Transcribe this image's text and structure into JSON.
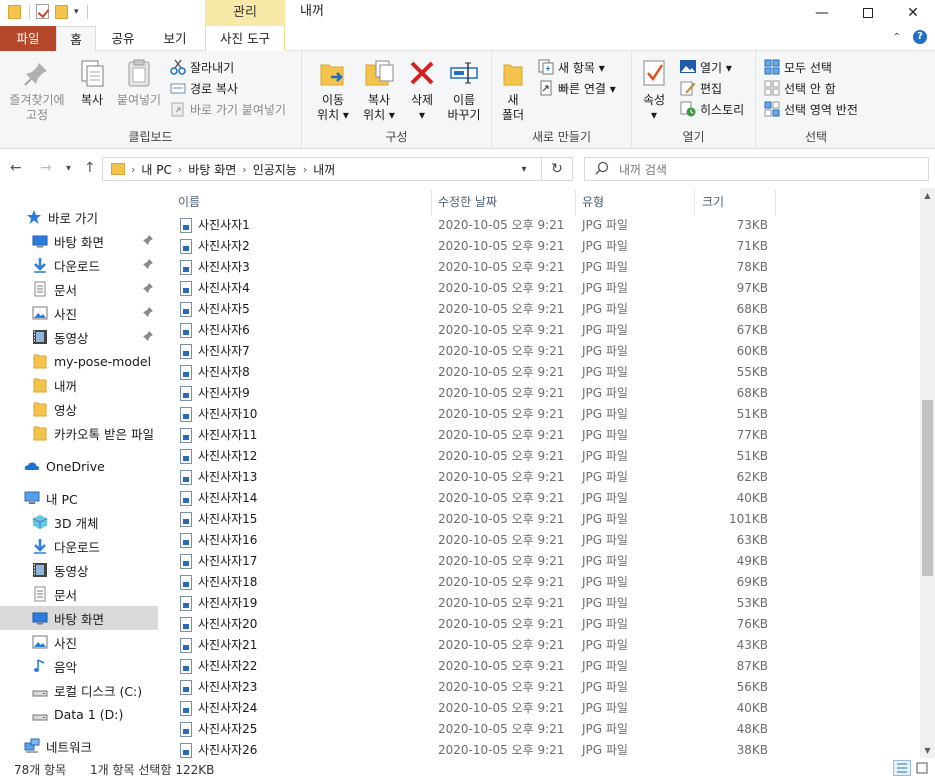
{
  "window": {
    "title": "내꺼",
    "context_tab_label": "관리",
    "minimize": "—",
    "close": "✕"
  },
  "ribbon_tabs": {
    "file": "파일",
    "home": "홈",
    "share": "공유",
    "view": "보기",
    "photo_tools": "사진 도구"
  },
  "ribbon": {
    "clipboard": {
      "label": "클립보드",
      "pin": [
        "즐겨찾기에",
        "고정"
      ],
      "copy": "복사",
      "paste": "붙여넣기",
      "cut": "잘라내기",
      "copy_path": "경로 복사",
      "paste_shortcut": "바로 가기 붙여넣기"
    },
    "organize": {
      "label": "구성",
      "move_to": [
        "이동",
        "위치 ▾"
      ],
      "copy_to": [
        "복사",
        "위치 ▾"
      ],
      "delete": [
        "삭제",
        "▾"
      ],
      "rename": [
        "이름",
        "바꾸기"
      ]
    },
    "new": {
      "label": "새로 만들기",
      "new_folder": [
        "새",
        "폴더"
      ],
      "new_item": "새 항목 ▾",
      "easy_access": "빠른 연결 ▾"
    },
    "open": {
      "label": "열기",
      "properties": [
        "속성",
        "▾"
      ],
      "open": "열기 ▾",
      "edit": "편집",
      "history": "히스토리"
    },
    "select": {
      "label": "선택",
      "select_all": "모두 선택",
      "select_none": "선택 안 함",
      "invert": "선택 영역 반전"
    }
  },
  "address": {
    "crumbs": [
      "내 PC",
      "바탕 화면",
      "인공지능",
      "내꺼"
    ],
    "search_placeholder": "내꺼 검색"
  },
  "nav": {
    "quick_access": "바로 가기",
    "items": [
      {
        "label": "바탕 화면",
        "icon": "desktop-icon",
        "pinned": true
      },
      {
        "label": "다운로드",
        "icon": "download-icon",
        "pinned": true
      },
      {
        "label": "문서",
        "icon": "document-icon",
        "pinned": true
      },
      {
        "label": "사진",
        "icon": "picture-icon",
        "pinned": true
      },
      {
        "label": "동영상",
        "icon": "video-icon",
        "pinned": true
      },
      {
        "label": "my-pose-model",
        "icon": "folder-icon",
        "pinned": false
      },
      {
        "label": "내꺼",
        "icon": "folder-icon",
        "pinned": false
      },
      {
        "label": "영상",
        "icon": "folder-icon",
        "pinned": false
      },
      {
        "label": "카카오톡 받은 파일",
        "icon": "folder-icon",
        "pinned": false
      }
    ],
    "onedrive": "OneDrive",
    "this_pc": "내 PC",
    "pc_items": [
      {
        "label": "3D 개체",
        "icon": "cube-icon"
      },
      {
        "label": "다운로드",
        "icon": "download-icon"
      },
      {
        "label": "동영상",
        "icon": "video-icon"
      },
      {
        "label": "문서",
        "icon": "document-icon"
      },
      {
        "label": "바탕 화면",
        "icon": "desktop-icon",
        "selected": true
      },
      {
        "label": "사진",
        "icon": "picture-icon"
      },
      {
        "label": "음악",
        "icon": "music-icon"
      },
      {
        "label": "로컬 디스크 (C:)",
        "icon": "drive-icon"
      },
      {
        "label": "Data 1 (D:)",
        "icon": "drive-icon"
      }
    ],
    "network": "네트워크"
  },
  "columns": {
    "name": "이름",
    "modified": "수정한 날짜",
    "type": "유형",
    "size": "크기"
  },
  "files": [
    {
      "name": "사진사자1",
      "date": "2020-10-05 오후 9:21",
      "type": "JPG 파일",
      "size": "73KB"
    },
    {
      "name": "사진사자2",
      "date": "2020-10-05 오후 9:21",
      "type": "JPG 파일",
      "size": "71KB"
    },
    {
      "name": "사진사자3",
      "date": "2020-10-05 오후 9:21",
      "type": "JPG 파일",
      "size": "78KB"
    },
    {
      "name": "사진사자4",
      "date": "2020-10-05 오후 9:21",
      "type": "JPG 파일",
      "size": "97KB"
    },
    {
      "name": "사진사자5",
      "date": "2020-10-05 오후 9:21",
      "type": "JPG 파일",
      "size": "68KB"
    },
    {
      "name": "사진사자6",
      "date": "2020-10-05 오후 9:21",
      "type": "JPG 파일",
      "size": "67KB"
    },
    {
      "name": "사진사자7",
      "date": "2020-10-05 오후 9:21",
      "type": "JPG 파일",
      "size": "60KB"
    },
    {
      "name": "사진사자8",
      "date": "2020-10-05 오후 9:21",
      "type": "JPG 파일",
      "size": "55KB"
    },
    {
      "name": "사진사자9",
      "date": "2020-10-05 오후 9:21",
      "type": "JPG 파일",
      "size": "68KB"
    },
    {
      "name": "사진사자10",
      "date": "2020-10-05 오후 9:21",
      "type": "JPG 파일",
      "size": "51KB"
    },
    {
      "name": "사진사자11",
      "date": "2020-10-05 오후 9:21",
      "type": "JPG 파일",
      "size": "77KB"
    },
    {
      "name": "사진사자12",
      "date": "2020-10-05 오후 9:21",
      "type": "JPG 파일",
      "size": "51KB"
    },
    {
      "name": "사진사자13",
      "date": "2020-10-05 오후 9:21",
      "type": "JPG 파일",
      "size": "62KB"
    },
    {
      "name": "사진사자14",
      "date": "2020-10-05 오후 9:21",
      "type": "JPG 파일",
      "size": "40KB"
    },
    {
      "name": "사진사자15",
      "date": "2020-10-05 오후 9:21",
      "type": "JPG 파일",
      "size": "101KB"
    },
    {
      "name": "사진사자16",
      "date": "2020-10-05 오후 9:21",
      "type": "JPG 파일",
      "size": "63KB"
    },
    {
      "name": "사진사자17",
      "date": "2020-10-05 오후 9:21",
      "type": "JPG 파일",
      "size": "49KB"
    },
    {
      "name": "사진사자18",
      "date": "2020-10-05 오후 9:21",
      "type": "JPG 파일",
      "size": "69KB"
    },
    {
      "name": "사진사자19",
      "date": "2020-10-05 오후 9:21",
      "type": "JPG 파일",
      "size": "53KB"
    },
    {
      "name": "사진사자20",
      "date": "2020-10-05 오후 9:21",
      "type": "JPG 파일",
      "size": "76KB"
    },
    {
      "name": "사진사자21",
      "date": "2020-10-05 오후 9:21",
      "type": "JPG 파일",
      "size": "43KB"
    },
    {
      "name": "사진사자22",
      "date": "2020-10-05 오후 9:21",
      "type": "JPG 파일",
      "size": "87KB"
    },
    {
      "name": "사진사자23",
      "date": "2020-10-05 오후 9:21",
      "type": "JPG 파일",
      "size": "56KB"
    },
    {
      "name": "사진사자24",
      "date": "2020-10-05 오후 9:21",
      "type": "JPG 파일",
      "size": "40KB"
    },
    {
      "name": "사진사자25",
      "date": "2020-10-05 오후 9:21",
      "type": "JPG 파일",
      "size": "48KB"
    },
    {
      "name": "사진사자26",
      "date": "2020-10-05 오후 9:21",
      "type": "JPG 파일",
      "size": "38KB"
    }
  ],
  "status": {
    "item_count": "78개 항목",
    "selection": "1개 항목 선택함 122KB"
  },
  "colors": {
    "file_tab": "#b5482a",
    "context_tab": "#f8e9a8",
    "accent_blue": "#1f6fc5",
    "folder_yellow": "#f3c34c",
    "delete_red": "#d32020"
  }
}
